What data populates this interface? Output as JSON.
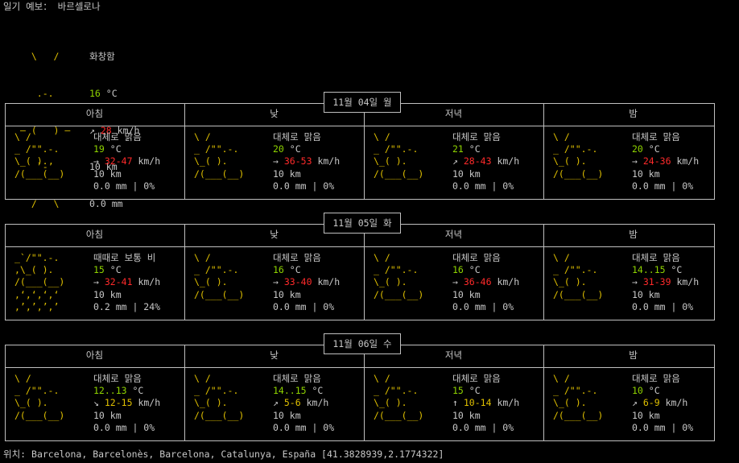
{
  "header": {
    "title": "일기 예보： 바르셀로나"
  },
  "current": {
    "icon": [
      "  \\   /",
      "   .-.",
      "― (   ) ―",
      "   `-’",
      "  /   \\"
    ],
    "condition": "화창함",
    "temp": "16",
    "temp_unit": "°C",
    "wind_arrow": "↗",
    "wind": "28",
    "wind_unit": "km/h",
    "visibility": "10 km",
    "precip": "0.0 mm"
  },
  "periods": [
    "아침",
    "낮",
    "저녁",
    "밤"
  ],
  "days": [
    {
      "label": "11월 04일 월",
      "slots": [
        {
          "condition": "대체로 맑음",
          "temp": "19",
          "wind_arrow": "→",
          "wind": "32-47",
          "visibility": "10 km",
          "precip": "0.0 mm | 0%",
          "icon": "sun_cloud"
        },
        {
          "condition": "대체로 맑음",
          "temp": "20",
          "wind_arrow": "→",
          "wind": "36-53",
          "visibility": "10 km",
          "precip": "0.0 mm | 0%",
          "icon": "sun_cloud"
        },
        {
          "condition": "대체로 맑음",
          "temp": "21",
          "wind_arrow": "↗",
          "wind": "28-43",
          "visibility": "10 km",
          "precip": "0.0 mm | 0%",
          "icon": "sun_cloud"
        },
        {
          "condition": "대체로 맑음",
          "temp": "20",
          "wind_arrow": "→",
          "wind": "24-36",
          "visibility": "10 km",
          "precip": "0.0 mm | 0%",
          "icon": "sun_cloud"
        }
      ]
    },
    {
      "label": "11월 05일 화",
      "slots": [
        {
          "condition": "때때로 보통 비",
          "temp": "15",
          "wind_arrow": "→",
          "wind": "32-41",
          "visibility": "10 km",
          "precip": "0.2 mm | 24%",
          "icon": "rain"
        },
        {
          "condition": "대체로 맑음",
          "temp": "16",
          "wind_arrow": "→",
          "wind": "33-40",
          "visibility": "10 km",
          "precip": "0.0 mm | 0%",
          "icon": "sun_cloud"
        },
        {
          "condition": "대체로 맑음",
          "temp": "16",
          "wind_arrow": "→",
          "wind": "36-46",
          "visibility": "10 km",
          "precip": "0.0 mm | 0%",
          "icon": "sun_cloud"
        },
        {
          "condition": "대체로 맑음",
          "temp": "14..15",
          "wind_arrow": "→",
          "wind": "31-39",
          "visibility": "10 km",
          "precip": "0.0 mm | 0%",
          "icon": "sun_cloud"
        }
      ]
    },
    {
      "label": "11월 06일 수",
      "slots": [
        {
          "condition": "대체로 맑음",
          "temp": "12..13",
          "wind_arrow": "↘",
          "wind": "12-15",
          "visibility": "10 km",
          "precip": "0.0 mm | 0%",
          "icon": "sun_cloud"
        },
        {
          "condition": "대체로 맑음",
          "temp": "14..15",
          "wind_arrow": "↗",
          "wind": "5-6",
          "visibility": "10 km",
          "precip": "0.0 mm | 0%",
          "icon": "sun_cloud"
        },
        {
          "condition": "대체로 맑음",
          "temp": "15",
          "wind_arrow": "↑",
          "wind": "10-14",
          "visibility": "10 km",
          "precip": "0.0 mm | 0%",
          "icon": "sun_cloud"
        },
        {
          "condition": "대체로 맑음",
          "temp": "10",
          "wind_arrow": "↗",
          "wind": "6-9",
          "visibility": "10 km",
          "precip": "0.0 mm | 0%",
          "icon": "sun_cloud"
        }
      ]
    }
  ],
  "icons": {
    "sun_cloud": [
      "  \\  /",
      "_ /\"\".-.",
      "  \\_(   ).",
      "  /(___(__)"
    ],
    "rain": [
      "_`/\"\".-.",
      " ,\\_(   ).",
      "  /(___(__)",
      "   ‚ʻ‚ʻ‚ʻ‚ʻ",
      "   ‚’‚’‚’‚’"
    ]
  },
  "footer": {
    "label": "위치:",
    "location": "Barcelona, Barcelonès, Barcelona, Catalunya, España [41.3828939,2.1774322]"
  },
  "colors": {
    "temp": "#8fd400",
    "wind_high": "#ff2a2a",
    "icon": "#e0c000"
  }
}
